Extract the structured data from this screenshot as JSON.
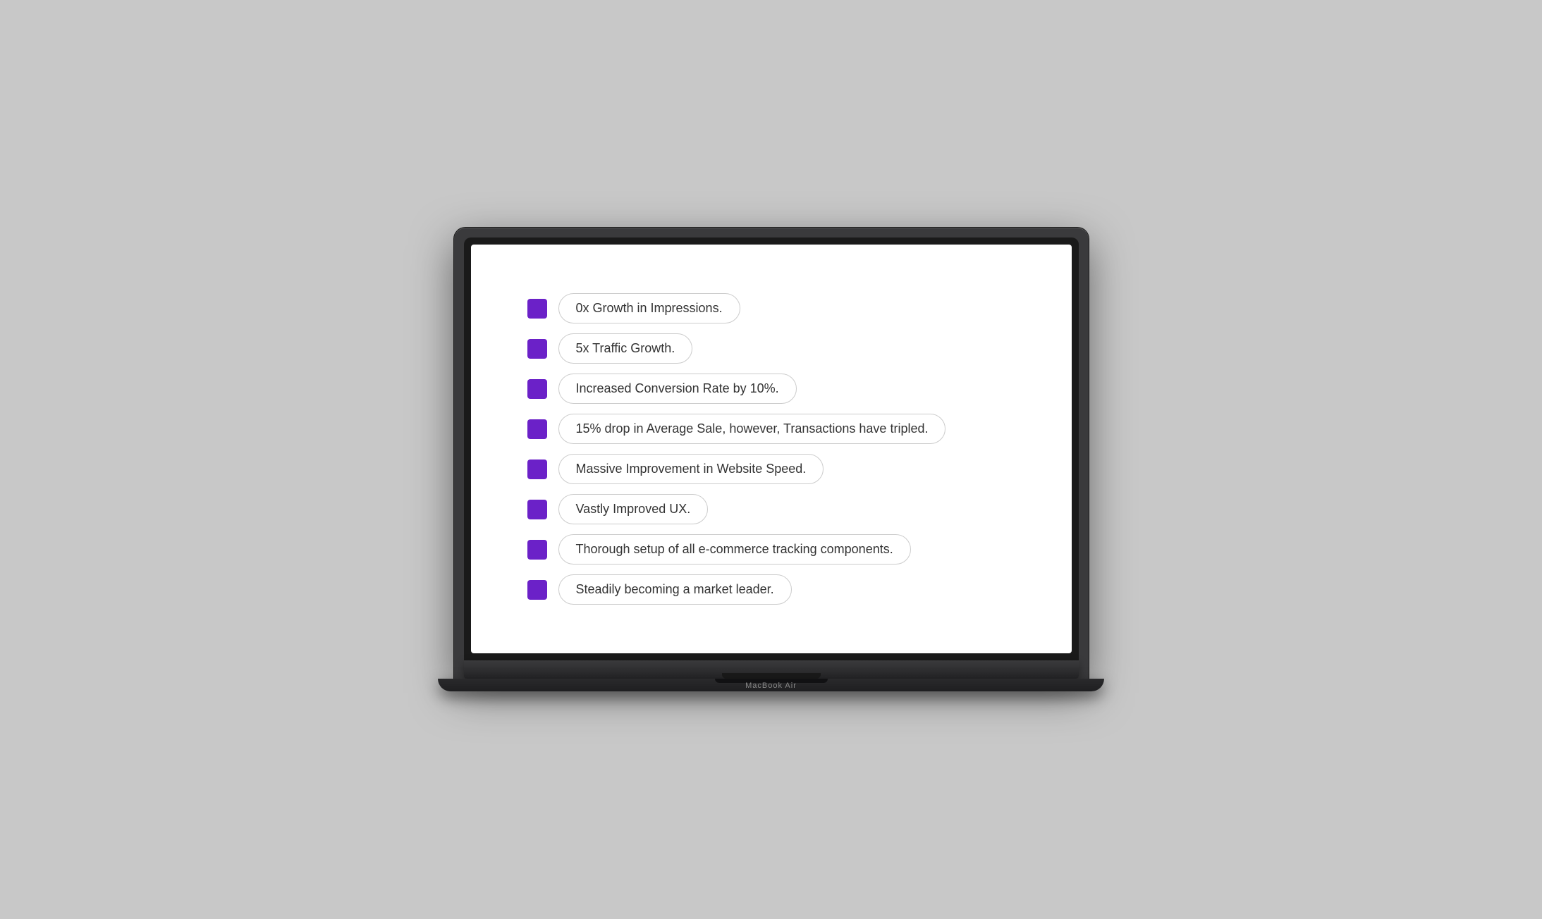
{
  "laptop": {
    "model_label": "MacBook Air"
  },
  "screen": {
    "items": [
      {
        "id": 1,
        "text": "0x Growth in Impressions."
      },
      {
        "id": 2,
        "text": "5x Traffic Growth."
      },
      {
        "id": 3,
        "text": "Increased Conversion Rate by 10%."
      },
      {
        "id": 4,
        "text": "15% drop in Average Sale, however, Transactions have tripled."
      },
      {
        "id": 5,
        "text": "Massive Improvement in Website Speed."
      },
      {
        "id": 6,
        "text": "Vastly Improved UX."
      },
      {
        "id": 7,
        "text": "Thorough setup of all e-commerce tracking components."
      },
      {
        "id": 8,
        "text": "Steadily becoming a market leader."
      }
    ]
  },
  "colors": {
    "bullet": "#6b21c8"
  }
}
